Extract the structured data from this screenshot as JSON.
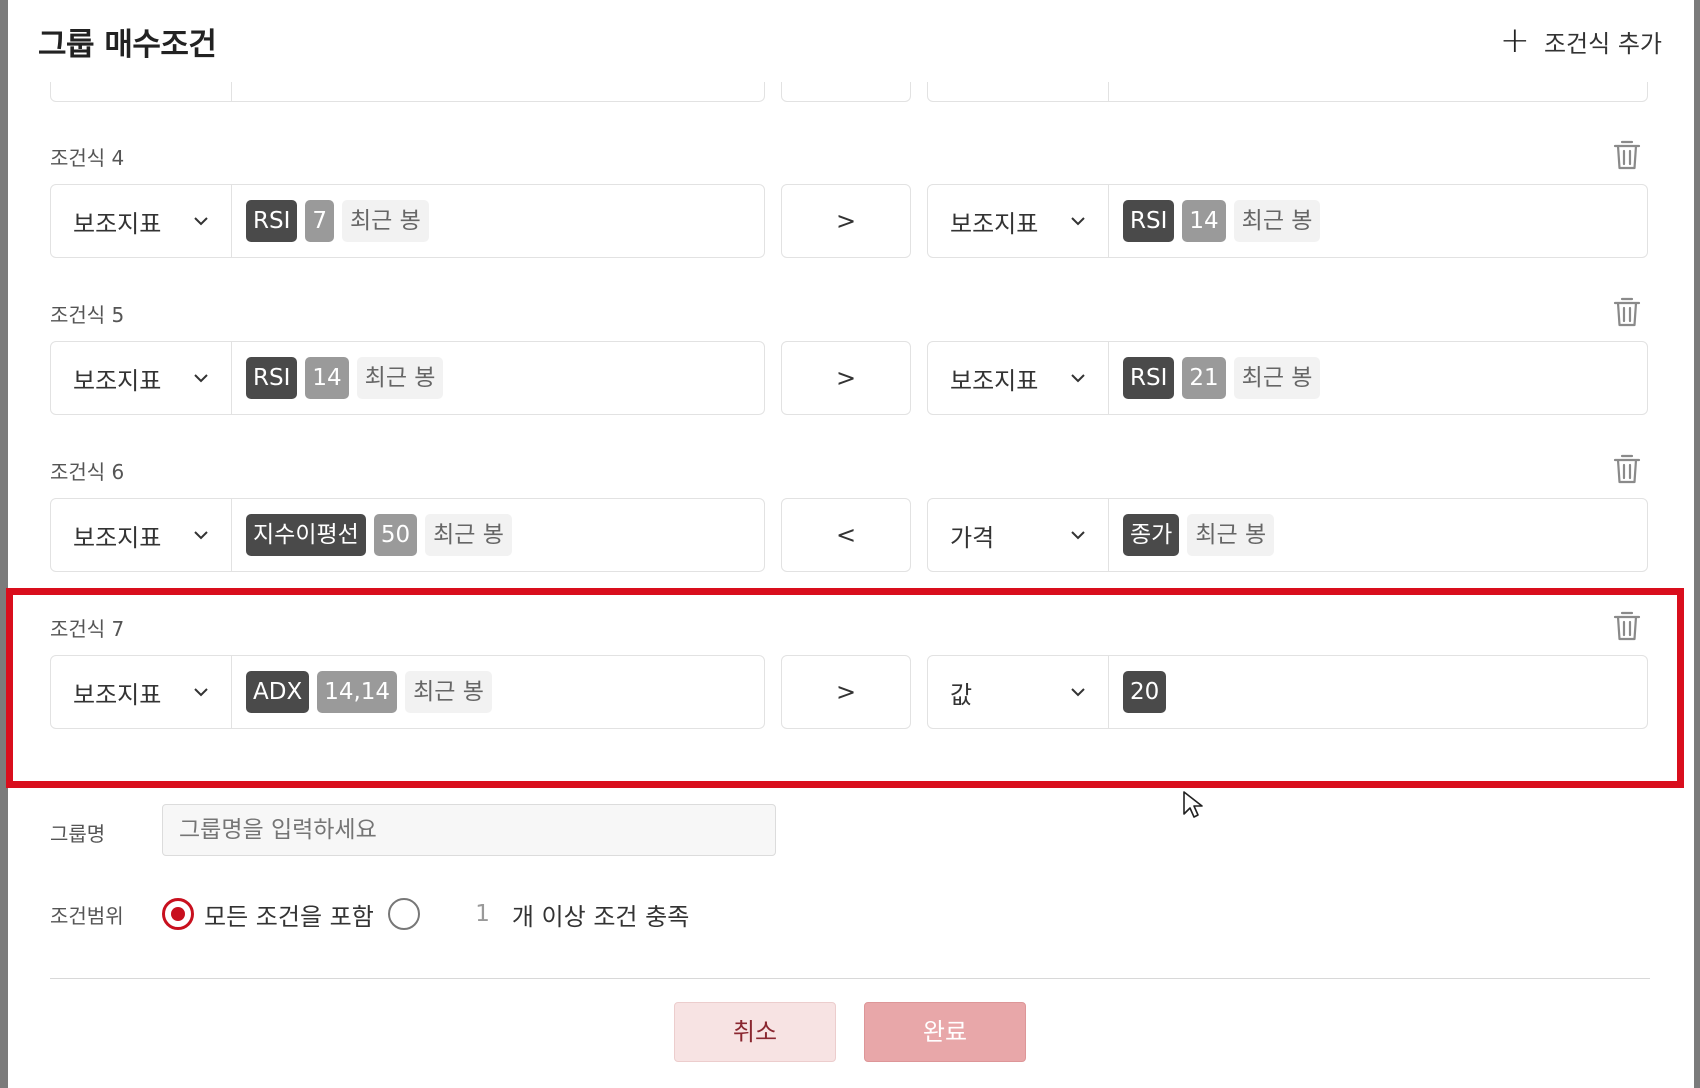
{
  "header": {
    "title": "그룹 매수조건",
    "add_label": "조건식 추가"
  },
  "conditions": [
    {
      "label": "조건식 4",
      "left": {
        "type": "보조지표",
        "tags": [
          "RSI",
          "7",
          "최근 봉"
        ]
      },
      "operator": ">",
      "right": {
        "type": "보조지표",
        "tags": [
          "RSI",
          "14",
          "최근 봉"
        ]
      }
    },
    {
      "label": "조건식 5",
      "left": {
        "type": "보조지표",
        "tags": [
          "RSI",
          "14",
          "최근 봉"
        ]
      },
      "operator": ">",
      "right": {
        "type": "보조지표",
        "tags": [
          "RSI",
          "21",
          "최근 봉"
        ]
      }
    },
    {
      "label": "조건식 6",
      "left": {
        "type": "보조지표",
        "tags": [
          "지수이평선",
          "50",
          "최근 봉"
        ]
      },
      "operator": "<",
      "right": {
        "type": "가격",
        "tags": [
          "종가",
          "최근 봉"
        ]
      }
    },
    {
      "label": "조건식 7",
      "left": {
        "type": "보조지표",
        "tags": [
          "ADX",
          "14,14",
          "최근 봉"
        ]
      },
      "operator": ">",
      "right": {
        "type": "값",
        "tags": [
          "20"
        ]
      }
    }
  ],
  "form": {
    "group_name_label": "그룹명",
    "group_name_placeholder": "그룹명을 입력하세요",
    "range_label": "조건범위",
    "option_all": "모든 조건을 포함",
    "count_value": "1",
    "option_count_suffix": "개 이상 조건 충족"
  },
  "buttons": {
    "cancel": "취소",
    "done": "완료"
  },
  "colors": {
    "accent": "#d90e1d",
    "tag_dark": "#4a4a4a",
    "tag_grey": "#9a9a9a"
  }
}
